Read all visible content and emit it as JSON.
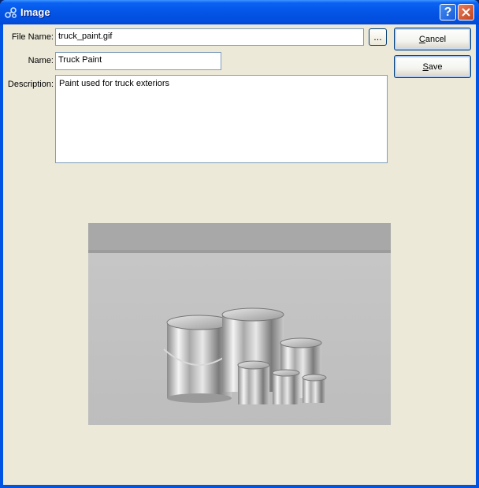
{
  "window": {
    "title": "Image"
  },
  "form": {
    "file_name_label": "File Name:",
    "file_name_value": "truck_paint.gif",
    "browse_label": "...",
    "name_label": "Name:",
    "name_value": "Truck Paint",
    "description_label": "Description:",
    "description_value": "Paint used for truck exteriors"
  },
  "buttons": {
    "cancel": {
      "mnemonic": "C",
      "rest": "ancel"
    },
    "save": {
      "mnemonic": "S",
      "rest": "ave"
    }
  }
}
